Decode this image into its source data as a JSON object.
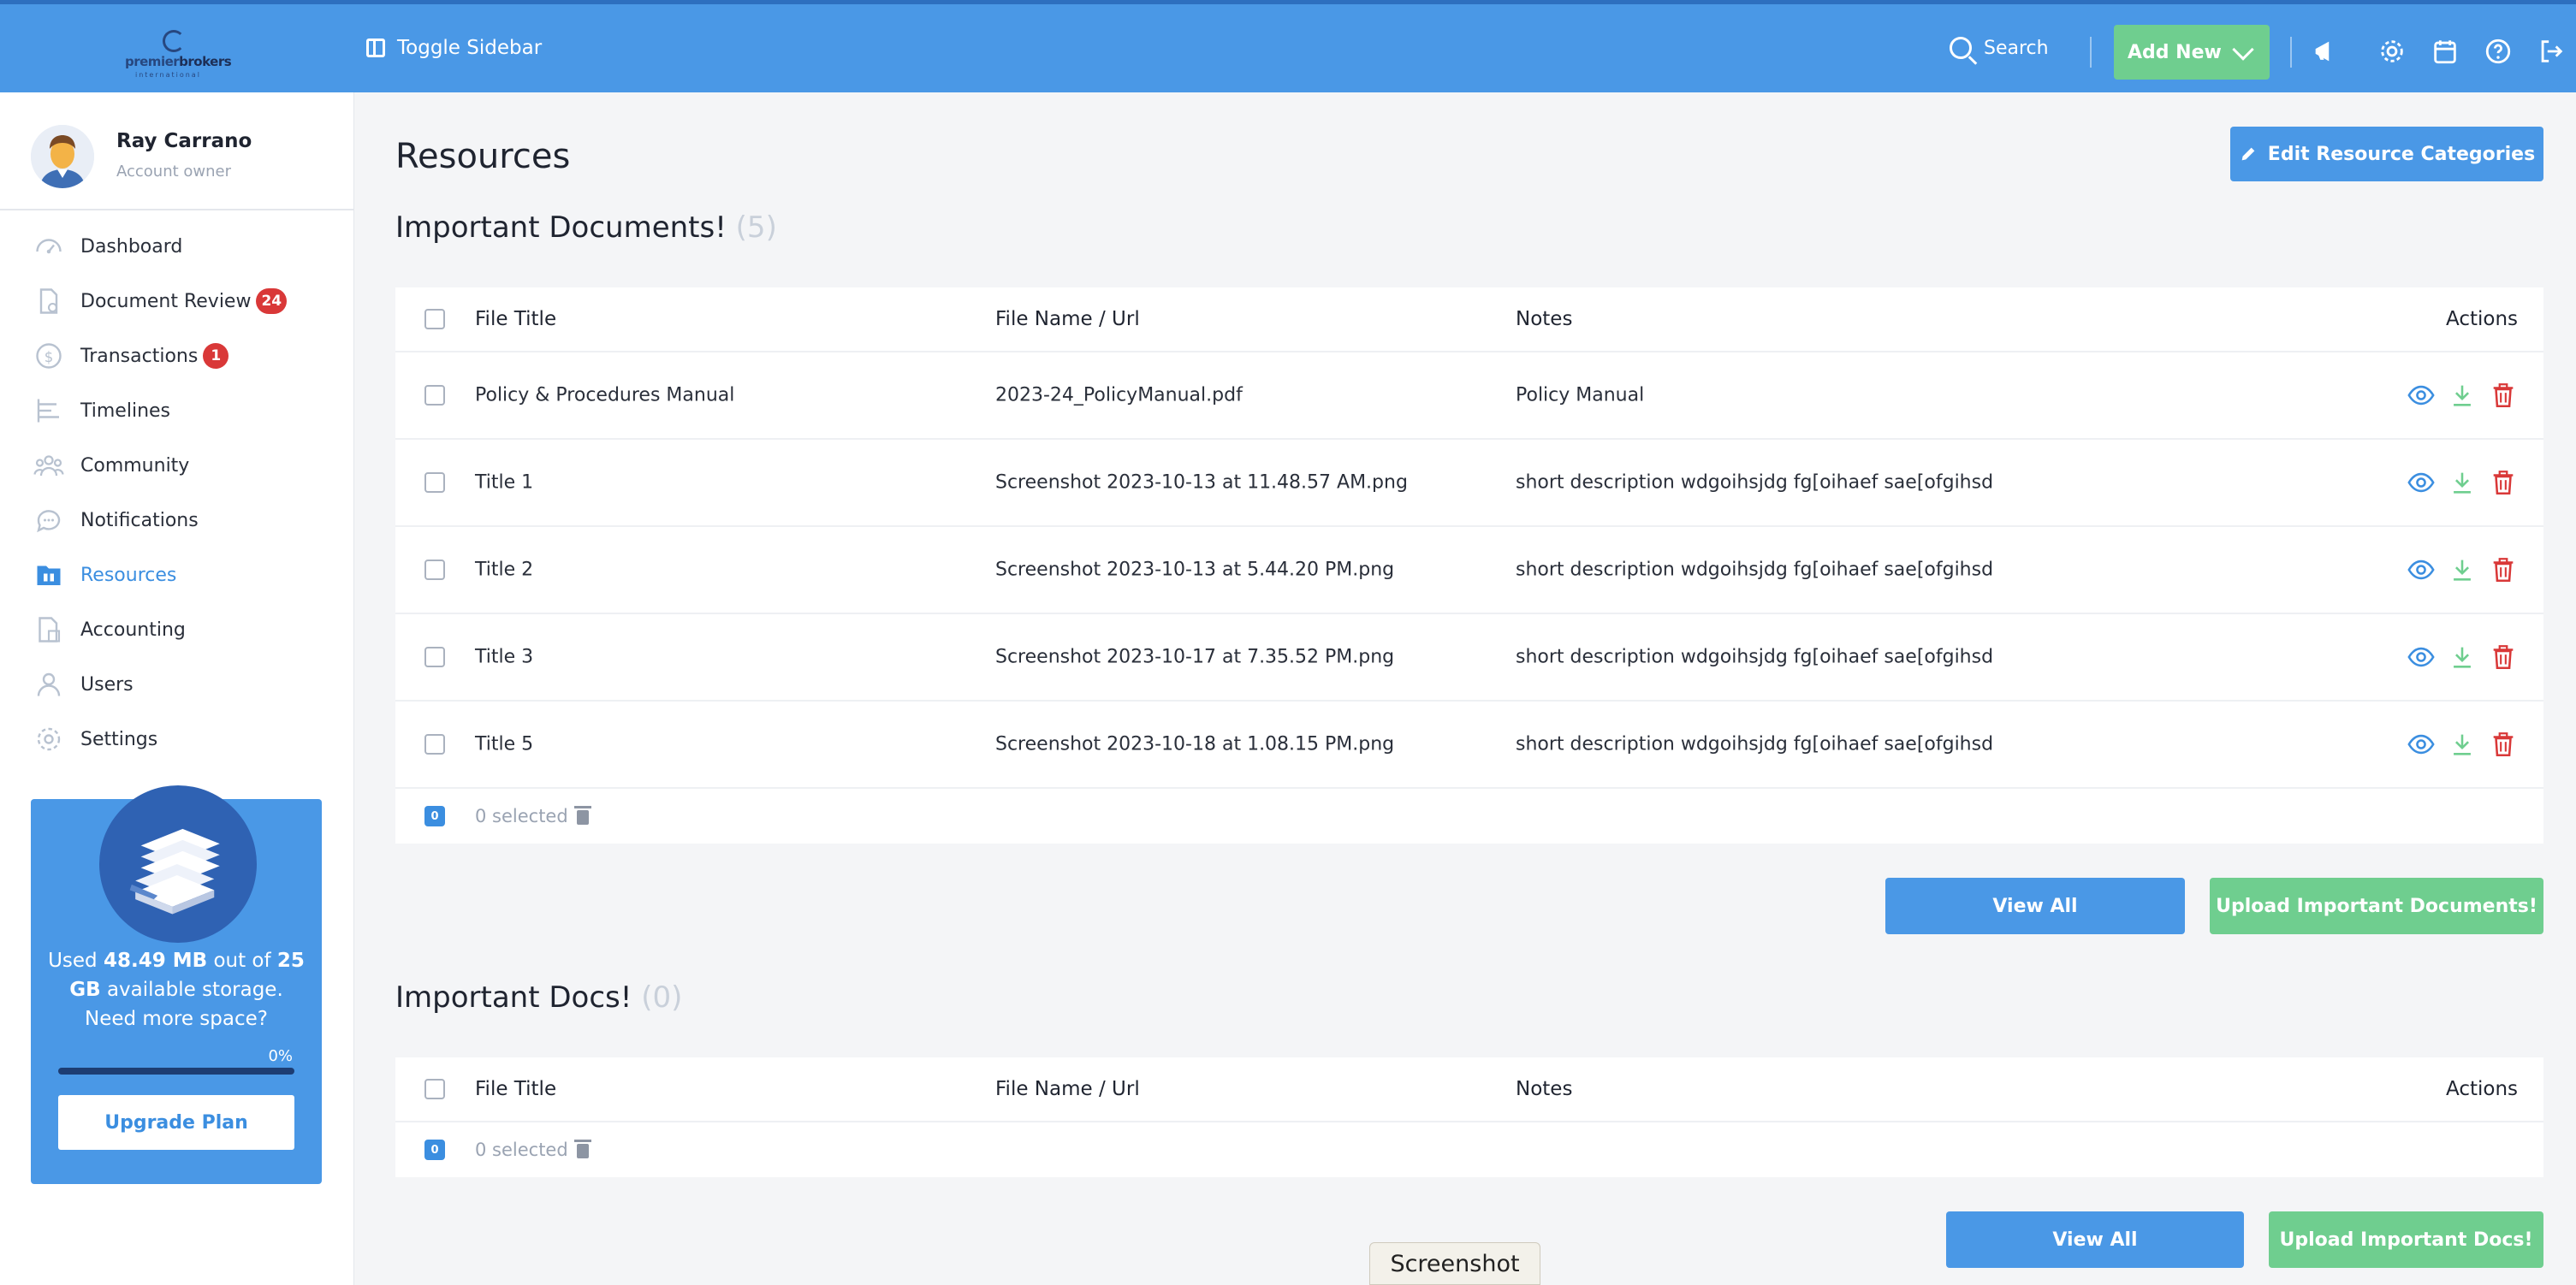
{
  "header": {
    "logo_primary": "premier",
    "logo_secondary": "brokers",
    "logo_sub": "international",
    "toggle_label": "Toggle Sidebar",
    "search_label": "Search",
    "add_new_label": "Add New",
    "accent_color": "#4a98e6"
  },
  "profile": {
    "name": "Ray Carrano",
    "role": "Account owner"
  },
  "sidebar": {
    "items": [
      {
        "label": "Dashboard",
        "icon": "dashboard-icon"
      },
      {
        "label": "Document Review",
        "icon": "document-review-icon",
        "badge": "24"
      },
      {
        "label": "Transactions",
        "icon": "transactions-icon",
        "badge": "1"
      },
      {
        "label": "Timelines",
        "icon": "timelines-icon"
      },
      {
        "label": "Community",
        "icon": "community-icon"
      },
      {
        "label": "Notifications",
        "icon": "notifications-icon"
      },
      {
        "label": "Resources",
        "icon": "resources-icon",
        "active": true
      },
      {
        "label": "Accounting",
        "icon": "accounting-icon"
      },
      {
        "label": "Users",
        "icon": "users-icon"
      },
      {
        "label": "Settings",
        "icon": "settings-icon"
      }
    ]
  },
  "storage": {
    "used_prefix": "Used ",
    "used": "48.49 MB",
    "out_of": " out of ",
    "total": "25 GB",
    "available": " available storage.",
    "need_more": "Need more space?",
    "percent_label": "0%",
    "percent_value": 0,
    "upgrade_label": "Upgrade Plan"
  },
  "main": {
    "title": "Resources",
    "edit_categories_label": "Edit Resource Categories",
    "sections": [
      {
        "title": "Important Documents!",
        "count": "(5)",
        "columns": [
          "File Title",
          "File Name / Url",
          "Notes",
          "Actions"
        ],
        "rows": [
          {
            "title": "Policy & Procedures Manual",
            "file": "2023-24_PolicyManual.pdf",
            "notes": "Policy Manual"
          },
          {
            "title": "Title 1",
            "file": "Screenshot 2023-10-13 at 11.48.57 AM.png",
            "notes": "short description wdgoihsjdg fg[oihaef sae[ofgihsd"
          },
          {
            "title": "Title 2",
            "file": "Screenshot 2023-10-13 at 5.44.20 PM.png",
            "notes": "short description wdgoihsjdg fg[oihaef sae[ofgihsd"
          },
          {
            "title": "Title 3",
            "file": "Screenshot 2023-10-17 at 7.35.52 PM.png",
            "notes": "short description wdgoihsjdg fg[oihaef sae[ofgihsd"
          },
          {
            "title": "Title 5",
            "file": "Screenshot 2023-10-18 at 1.08.15 PM.png",
            "notes": "short description wdgoihsjdg fg[oihaef sae[ofgihsd"
          }
        ],
        "selected_count": "0",
        "selected_label": "0 selected",
        "view_all_label": "View All",
        "upload_label": "Upload Important Documents!"
      },
      {
        "title": "Important Docs!",
        "count": "(0)",
        "columns": [
          "File Title",
          "File Name / Url",
          "Notes",
          "Actions"
        ],
        "rows": [],
        "selected_count": "0",
        "selected_label": "0 selected",
        "view_all_label": "View All",
        "upload_label": "Upload Important Docs!"
      }
    ]
  },
  "tooltip": {
    "label": "Screenshot"
  }
}
